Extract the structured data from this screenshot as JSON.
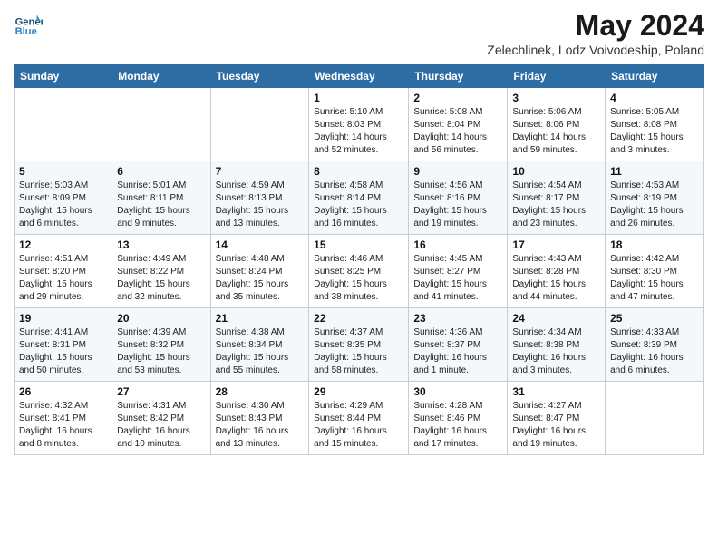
{
  "header": {
    "logo_line1": "General",
    "logo_line2": "Blue",
    "title": "May 2024",
    "subtitle": "Zelechlinek, Lodz Voivodeship, Poland"
  },
  "columns": [
    "Sunday",
    "Monday",
    "Tuesday",
    "Wednesday",
    "Thursday",
    "Friday",
    "Saturday"
  ],
  "weeks": [
    [
      {
        "day": "",
        "info": ""
      },
      {
        "day": "",
        "info": ""
      },
      {
        "day": "",
        "info": ""
      },
      {
        "day": "1",
        "info": "Sunrise: 5:10 AM\nSunset: 8:03 PM\nDaylight: 14 hours\nand 52 minutes."
      },
      {
        "day": "2",
        "info": "Sunrise: 5:08 AM\nSunset: 8:04 PM\nDaylight: 14 hours\nand 56 minutes."
      },
      {
        "day": "3",
        "info": "Sunrise: 5:06 AM\nSunset: 8:06 PM\nDaylight: 14 hours\nand 59 minutes."
      },
      {
        "day": "4",
        "info": "Sunrise: 5:05 AM\nSunset: 8:08 PM\nDaylight: 15 hours\nand 3 minutes."
      }
    ],
    [
      {
        "day": "5",
        "info": "Sunrise: 5:03 AM\nSunset: 8:09 PM\nDaylight: 15 hours\nand 6 minutes."
      },
      {
        "day": "6",
        "info": "Sunrise: 5:01 AM\nSunset: 8:11 PM\nDaylight: 15 hours\nand 9 minutes."
      },
      {
        "day": "7",
        "info": "Sunrise: 4:59 AM\nSunset: 8:13 PM\nDaylight: 15 hours\nand 13 minutes."
      },
      {
        "day": "8",
        "info": "Sunrise: 4:58 AM\nSunset: 8:14 PM\nDaylight: 15 hours\nand 16 minutes."
      },
      {
        "day": "9",
        "info": "Sunrise: 4:56 AM\nSunset: 8:16 PM\nDaylight: 15 hours\nand 19 minutes."
      },
      {
        "day": "10",
        "info": "Sunrise: 4:54 AM\nSunset: 8:17 PM\nDaylight: 15 hours\nand 23 minutes."
      },
      {
        "day": "11",
        "info": "Sunrise: 4:53 AM\nSunset: 8:19 PM\nDaylight: 15 hours\nand 26 minutes."
      }
    ],
    [
      {
        "day": "12",
        "info": "Sunrise: 4:51 AM\nSunset: 8:20 PM\nDaylight: 15 hours\nand 29 minutes."
      },
      {
        "day": "13",
        "info": "Sunrise: 4:49 AM\nSunset: 8:22 PM\nDaylight: 15 hours\nand 32 minutes."
      },
      {
        "day": "14",
        "info": "Sunrise: 4:48 AM\nSunset: 8:24 PM\nDaylight: 15 hours\nand 35 minutes."
      },
      {
        "day": "15",
        "info": "Sunrise: 4:46 AM\nSunset: 8:25 PM\nDaylight: 15 hours\nand 38 minutes."
      },
      {
        "day": "16",
        "info": "Sunrise: 4:45 AM\nSunset: 8:27 PM\nDaylight: 15 hours\nand 41 minutes."
      },
      {
        "day": "17",
        "info": "Sunrise: 4:43 AM\nSunset: 8:28 PM\nDaylight: 15 hours\nand 44 minutes."
      },
      {
        "day": "18",
        "info": "Sunrise: 4:42 AM\nSunset: 8:30 PM\nDaylight: 15 hours\nand 47 minutes."
      }
    ],
    [
      {
        "day": "19",
        "info": "Sunrise: 4:41 AM\nSunset: 8:31 PM\nDaylight: 15 hours\nand 50 minutes."
      },
      {
        "day": "20",
        "info": "Sunrise: 4:39 AM\nSunset: 8:32 PM\nDaylight: 15 hours\nand 53 minutes."
      },
      {
        "day": "21",
        "info": "Sunrise: 4:38 AM\nSunset: 8:34 PM\nDaylight: 15 hours\nand 55 minutes."
      },
      {
        "day": "22",
        "info": "Sunrise: 4:37 AM\nSunset: 8:35 PM\nDaylight: 15 hours\nand 58 minutes."
      },
      {
        "day": "23",
        "info": "Sunrise: 4:36 AM\nSunset: 8:37 PM\nDaylight: 16 hours\nand 1 minute."
      },
      {
        "day": "24",
        "info": "Sunrise: 4:34 AM\nSunset: 8:38 PM\nDaylight: 16 hours\nand 3 minutes."
      },
      {
        "day": "25",
        "info": "Sunrise: 4:33 AM\nSunset: 8:39 PM\nDaylight: 16 hours\nand 6 minutes."
      }
    ],
    [
      {
        "day": "26",
        "info": "Sunrise: 4:32 AM\nSunset: 8:41 PM\nDaylight: 16 hours\nand 8 minutes."
      },
      {
        "day": "27",
        "info": "Sunrise: 4:31 AM\nSunset: 8:42 PM\nDaylight: 16 hours\nand 10 minutes."
      },
      {
        "day": "28",
        "info": "Sunrise: 4:30 AM\nSunset: 8:43 PM\nDaylight: 16 hours\nand 13 minutes."
      },
      {
        "day": "29",
        "info": "Sunrise: 4:29 AM\nSunset: 8:44 PM\nDaylight: 16 hours\nand 15 minutes."
      },
      {
        "day": "30",
        "info": "Sunrise: 4:28 AM\nSunset: 8:46 PM\nDaylight: 16 hours\nand 17 minutes."
      },
      {
        "day": "31",
        "info": "Sunrise: 4:27 AM\nSunset: 8:47 PM\nDaylight: 16 hours\nand 19 minutes."
      },
      {
        "day": "",
        "info": ""
      }
    ]
  ]
}
